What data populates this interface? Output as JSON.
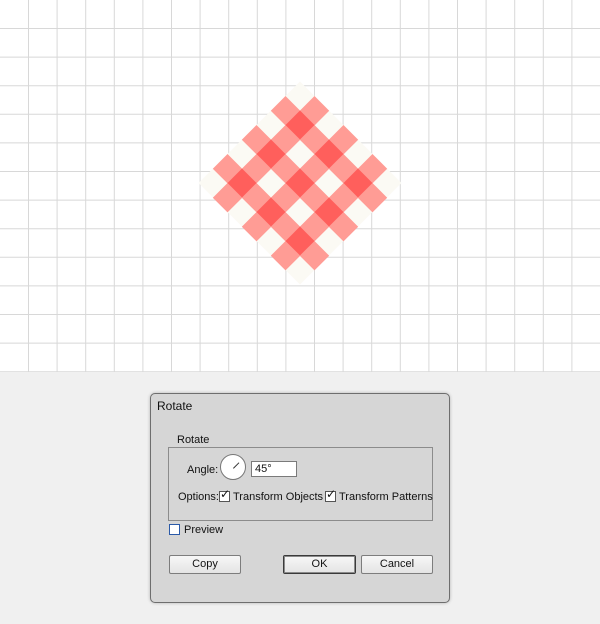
{
  "dialog": {
    "title": "Rotate",
    "group_label": "Rotate",
    "angle_label": "Angle:",
    "angle_value": "45°",
    "options_label": "Options:",
    "transform_objects": {
      "label": "Transform Objects",
      "checked": true
    },
    "transform_patterns": {
      "label": "Transform Patterns",
      "checked": true
    },
    "preview": {
      "label": "Preview",
      "checked": false
    },
    "buttons": {
      "copy": "Copy",
      "ok": "OK",
      "cancel": "Cancel"
    }
  },
  "pattern": {
    "light_color": "#ff9c95",
    "dark_color": "#ff5f5c",
    "halo_color": "#fbfaf4",
    "grid_color": "#d8d8d8"
  },
  "icons": {
    "checkmark": "check-icon",
    "dial": "angle-dial-icon"
  }
}
